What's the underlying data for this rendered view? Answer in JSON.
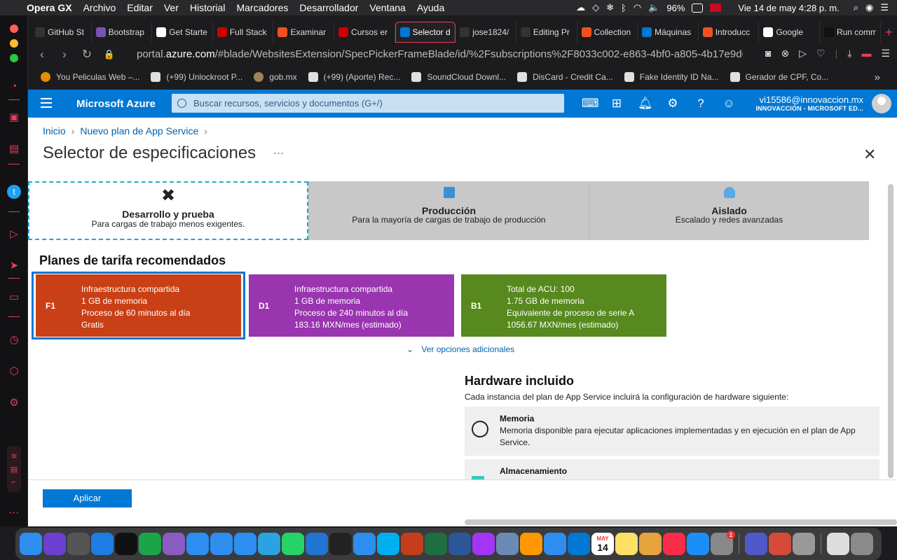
{
  "menubar": {
    "app": "Opera GX",
    "items": [
      "Archivo",
      "Editar",
      "Ver",
      "Historial",
      "Marcadores",
      "Desarrollador",
      "Ventana",
      "Ayuda"
    ],
    "battery": "96%",
    "datetime": "Vie 14 de may  4:28 p. m."
  },
  "tabs": [
    {
      "title": "GitHub St",
      "icon": "github-icon"
    },
    {
      "title": "Bootstrap",
      "icon": "bootstrap-icon"
    },
    {
      "title": "Get Starte",
      "icon": "stack-icon"
    },
    {
      "title": "Full Stack",
      "icon": "udemy-icon"
    },
    {
      "title": "Examinar",
      "icon": "ms-icon"
    },
    {
      "title": "Cursos er",
      "icon": "udemy-icon"
    },
    {
      "title": "Selector d",
      "icon": "azure-icon",
      "active": true
    },
    {
      "title": "jose1824/",
      "icon": "github-icon"
    },
    {
      "title": "Editing Pr",
      "icon": "github-icon"
    },
    {
      "title": "Collection",
      "icon": "ms-icon"
    },
    {
      "title": "Máquinas",
      "icon": "azure-icon"
    },
    {
      "title": "Introducc",
      "icon": "ms-icon"
    },
    {
      "title": "Google",
      "icon": "google-icon"
    },
    {
      "title": "Run comm",
      "icon": "terminal-icon"
    }
  ],
  "address": {
    "prefix": "portal.",
    "domain": "azure.com",
    "path": "/#blade/WebsitesExtension/SpecPickerFrameBlade/id/%2Fsubscriptions%2F8033c002-e863-4bf0-a805-4b17e9d6c"
  },
  "bookmarks": [
    "You Peliculas Web –...",
    "(+99) Unlockroot P...",
    "gob.mx",
    "(+99) (Aporte) Rec...",
    "SoundCloud Downl...",
    "DisCard - Credit Ca...",
    "Fake Identity ID Na...",
    "Gerador de CPF, Co..."
  ],
  "azure": {
    "brand": "Microsoft Azure",
    "search_placeholder": "Buscar recursos, servicios y documentos (G+/)",
    "user_name": "vi15586@innovaccion.mx",
    "user_dir": "INNOVACCIÓN - MICROSOFT ED..."
  },
  "breadcrumb": [
    "Inicio",
    "Nuevo plan de App Service"
  ],
  "blade": {
    "title": "Selector de especificaciones",
    "more": "···"
  },
  "tiers": [
    {
      "name": "Desarrollo y prueba",
      "desc": "Para cargas de trabajo menos exigentes.",
      "selected": true
    },
    {
      "name": "Producción",
      "desc": "Para la mayoría de cargas de trabajo de producción"
    },
    {
      "name": "Aislado",
      "desc": "Escalado y redes avanzadas"
    }
  ],
  "plans_title": "Planes de tarifa recomendados",
  "plans": [
    {
      "code": "F1",
      "color": "#c94016",
      "lines": [
        "Infraestructura compartida",
        "1 GB de memoria",
        "Proceso de 60 minutos al día",
        "Gratis"
      ]
    },
    {
      "code": "D1",
      "color": "#9a35b0",
      "lines": [
        "Infraestructura compartida",
        "1 GB de memoria",
        "Proceso de 240 minutos al día",
        "183.16 MXN/mes (estimado)"
      ]
    },
    {
      "code": "B1",
      "color": "#57891e",
      "lines": [
        "Total de ACU: 100",
        "1.75 GB de memoria",
        "Equivalente de proceso de serie A",
        "1056.67 MXN/mes (estimado)"
      ]
    }
  ],
  "more_options": "Ver opciones adicionales",
  "hardware": {
    "title": "Hardware incluido",
    "desc": "Cada instancia del plan de App Service incluirá la configuración de hardware siguiente:",
    "items": [
      {
        "name": "Memoria",
        "desc": "Memoria disponible para ejecutar aplicaciones implementadas y en ejecución en el plan de App Service."
      },
      {
        "name": "Almacenamiento",
        "desc": ""
      }
    ]
  },
  "apply_label": "Aplicar",
  "dock_badge": "1",
  "dock_calendar": {
    "month": "MAY",
    "day": "14"
  }
}
